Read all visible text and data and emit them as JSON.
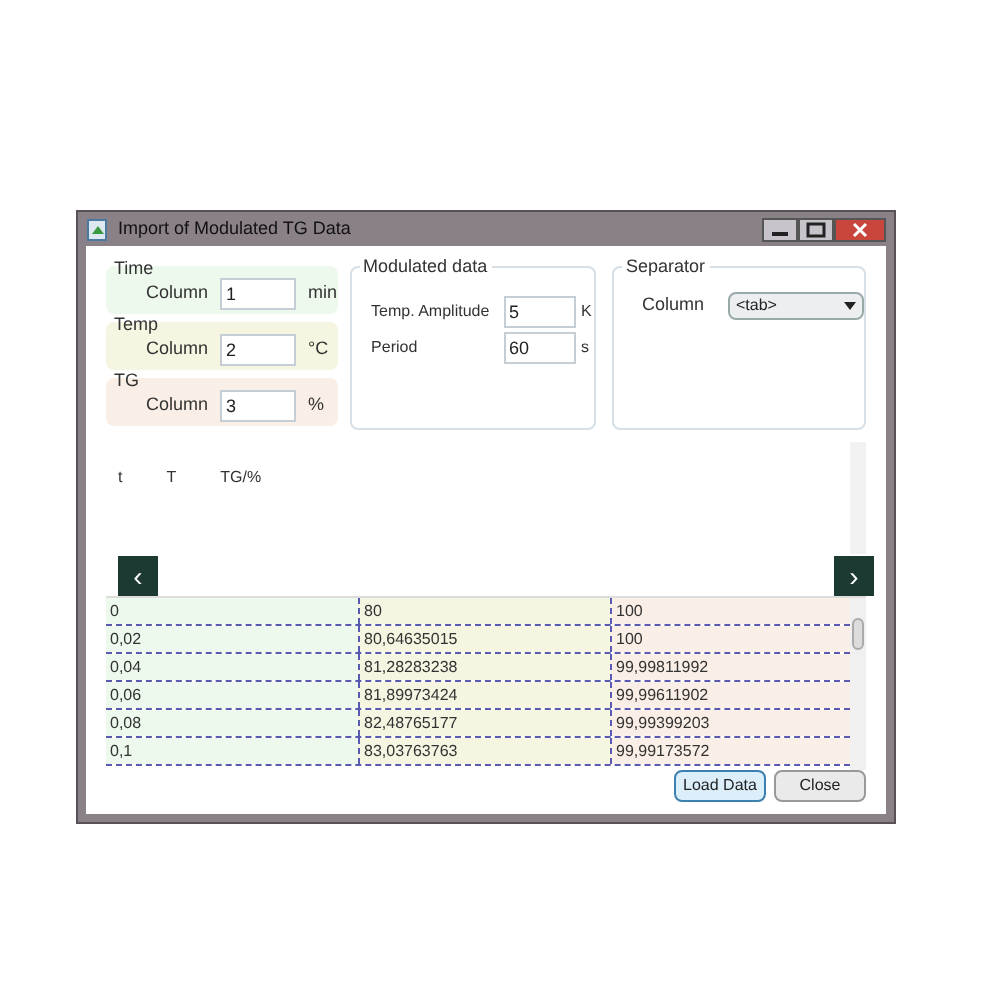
{
  "window": {
    "title": "Import of Modulated TG Data"
  },
  "column_groups": [
    {
      "title": "Time",
      "label": "Column",
      "value": "1",
      "unit": "min",
      "color": "#eef9ee"
    },
    {
      "title": "Temp",
      "label": "Column",
      "value": "2",
      "unit": "°C",
      "color": "#f6f5e2"
    },
    {
      "title": "TG",
      "label": "Column",
      "value": "3",
      "unit": "%",
      "color": "#f9efe6"
    }
  ],
  "modulated_data": {
    "title": "Modulated data",
    "fields": [
      {
        "label": "Temp. Amplitude",
        "value": "5",
        "unit": "K"
      },
      {
        "label": "Period",
        "value": "60",
        "unit": "s"
      }
    ]
  },
  "separator": {
    "title": "Separator",
    "label": "Column",
    "value": "<tab>"
  },
  "preview": {
    "headers": [
      "t",
      "T",
      "TG/%"
    ],
    "prev_button": "‹",
    "next_button": "›"
  },
  "table": {
    "rows": [
      [
        "0",
        "80",
        "100"
      ],
      [
        "0,02",
        "80,64635015",
        "100"
      ],
      [
        "0,04",
        "81,28283238",
        "99,99811992"
      ],
      [
        "0,06",
        "81,89973424",
        "99,99611902"
      ],
      [
        "0,08",
        "82,48765177",
        "99,99399203"
      ],
      [
        "0,1",
        "83,03763763",
        "99,99173572"
      ]
    ]
  },
  "buttons": [
    {
      "label": "Load Data",
      "default": true
    },
    {
      "label": "Close",
      "default": false
    }
  ]
}
